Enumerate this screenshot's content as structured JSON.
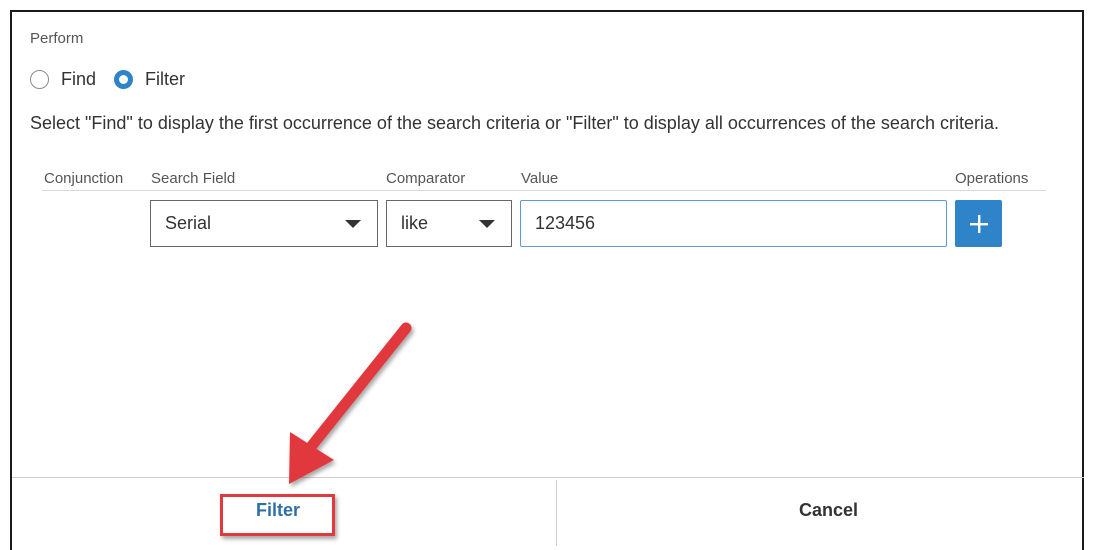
{
  "perform": {
    "label": "Perform",
    "options": [
      {
        "label": "Find",
        "selected": false
      },
      {
        "label": "Filter",
        "selected": true
      }
    ],
    "help_text": "Select \"Find\" to display the first occurrence of the search criteria or \"Filter\" to display all occurrences of the search criteria."
  },
  "criteria_table": {
    "headers": {
      "conjunction": "Conjunction",
      "search_field": "Search Field",
      "comparator": "Comparator",
      "value": "Value",
      "operations": "Operations"
    },
    "row": {
      "search_field": "Serial",
      "comparator": "like",
      "value": "123456",
      "add_icon": "plus-icon"
    }
  },
  "footer": {
    "filter_label": "Filter",
    "cancel_label": "Cancel"
  },
  "colors": {
    "accent": "#2f83c8",
    "annotation": "#e0393e"
  }
}
